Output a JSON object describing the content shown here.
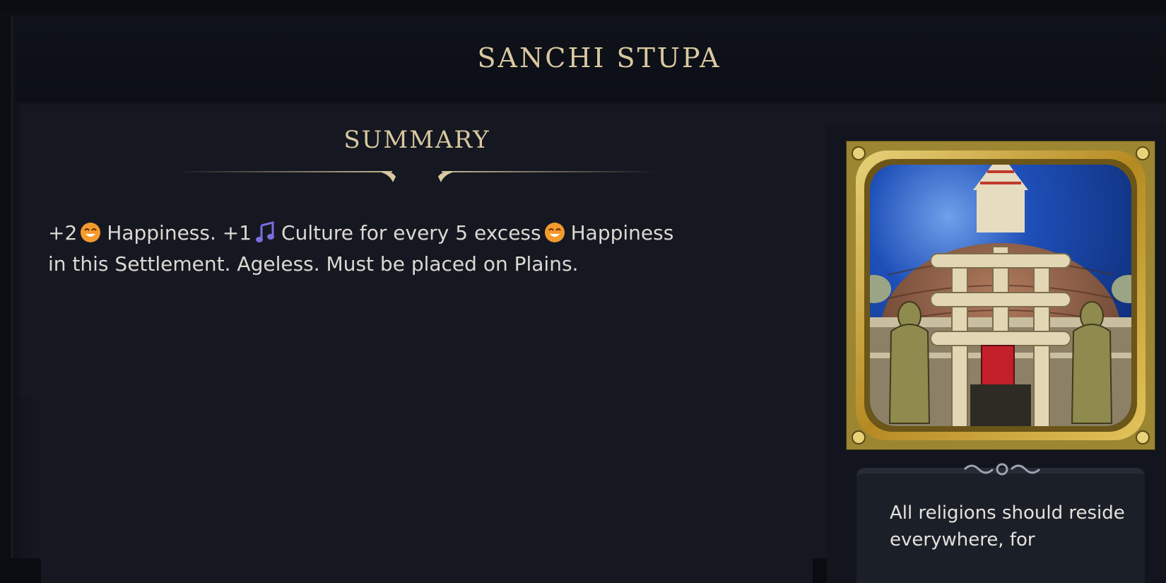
{
  "header": {
    "title": "SANCHI STUPA"
  },
  "summary": {
    "heading": "SUMMARY",
    "text_parts": {
      "p1": "+2",
      "p2": "Happiness. +1",
      "p3": "Culture for every 5 excess",
      "p4": "Happiness",
      "p5": "in this Settlement. Ageless. Must be placed on Plains."
    },
    "icons": [
      "happiness-icon",
      "culture-icon",
      "happiness-icon"
    ]
  },
  "side": {
    "quote": "All religions should reside everywhere, for",
    "portrait_subject": "sanchi-stupa-wonder-icon"
  },
  "colors": {
    "title_gold": "#d9c8a0",
    "frame_gold": "#c8a43a",
    "happiness_orange": "#f0932b",
    "culture_purple": "#7a6ee0",
    "sky_blue": "#1e4fb8"
  }
}
